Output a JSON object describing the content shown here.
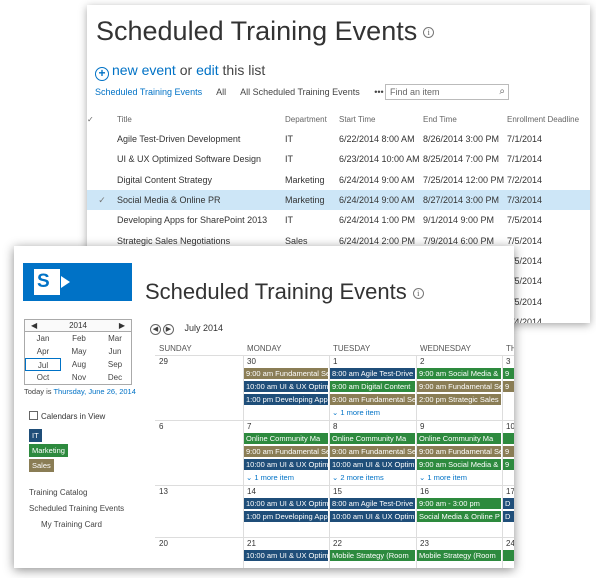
{
  "back": {
    "title": "Scheduled Training Events",
    "info_icon": "info-icon",
    "new_event": "new event",
    "or_text": "or",
    "edit": "edit",
    "this_list": "this list",
    "views": [
      "Scheduled Training Events",
      "All",
      "All Scheduled Training Events",
      "•••"
    ],
    "search_placeholder": "Find an item",
    "columns": [
      "Title",
      "Department",
      "Start Time",
      "End Time",
      "Enrollment Deadline"
    ],
    "rows": [
      {
        "title": "Agile Test-Driven Development",
        "dept": "IT",
        "start": "6/22/2014 8:00 AM",
        "end": "8/26/2014 3:00 PM",
        "deadline": "7/1/2014",
        "selected": false
      },
      {
        "title": "UI & UX Optimized Software Design",
        "dept": "IT",
        "start": "6/23/2014 10:00 AM",
        "end": "8/25/2014 7:00 PM",
        "deadline": "7/1/2014",
        "selected": false
      },
      {
        "title": "Digital Content Strategy",
        "dept": "Marketing",
        "start": "6/24/2014 9:00 AM",
        "end": "7/25/2014 12:00 PM",
        "deadline": "7/2/2014",
        "selected": false
      },
      {
        "title": "Social Media & Online PR",
        "dept": "Marketing",
        "start": "6/24/2014 9:00 AM",
        "end": "8/27/2014 3:00 PM",
        "deadline": "7/3/2014",
        "selected": true
      },
      {
        "title": "Developing Apps for SharePoint 2013",
        "dept": "IT",
        "start": "6/24/2014 1:00 PM",
        "end": "9/1/2014 9:00 PM",
        "deadline": "7/5/2014",
        "selected": false
      },
      {
        "title": "Strategic Sales Negotiations",
        "dept": "Sales",
        "start": "6/24/2014 2:00 PM",
        "end": "7/9/2014 6:00 PM",
        "deadline": "7/5/2014",
        "selected": false
      }
    ],
    "extra_deadlines": [
      "7/5/2014",
      "7/5/2014",
      "7/5/2014",
      "7/4/2014"
    ]
  },
  "front": {
    "title": "Scheduled Training Events",
    "logo_letter": "S",
    "mini_cal": {
      "year": "2014",
      "months": [
        "Jan",
        "Feb",
        "Mar",
        "Apr",
        "May",
        "Jun",
        "Jul",
        "Aug",
        "Sep",
        "Oct",
        "Nov",
        "Dec"
      ],
      "current": "Jul",
      "today_label": "Today is",
      "today_date": "Thursday, June 26, 2014"
    },
    "calendars_label": "Calendars in View",
    "calendars": [
      {
        "name": "IT",
        "color": "#1f4e79"
      },
      {
        "name": "Marketing",
        "color": "#2d8a3e"
      },
      {
        "name": "Sales",
        "color": "#8a7d55"
      }
    ],
    "nav_links": [
      "Training Catalog",
      "Scheduled Training Events",
      "My Training Card"
    ],
    "month_label": "July 2014",
    "day_headers": [
      "SUNDAY",
      "MONDAY",
      "TUESDAY",
      "WEDNESDAY",
      "TH"
    ],
    "weeks": [
      {
        "days": [
          "29",
          "30",
          "1",
          "2",
          "3"
        ],
        "events": [
          {
            "col": 1,
            "row": 0,
            "text": "9:00 am Fundamental Se",
            "color": "olive"
          },
          {
            "col": 1,
            "row": 1,
            "text": "10:00 am UI & UX Optim",
            "color": "navy"
          },
          {
            "col": 1,
            "row": 2,
            "text": "1:00 pm Developing App",
            "color": "navy"
          },
          {
            "col": 2,
            "row": 0,
            "text": "8:00 am Agile Test-Drive",
            "color": "navy"
          },
          {
            "col": 2,
            "row": 1,
            "text": "9:00 am Digital Content",
            "color": "green"
          },
          {
            "col": 2,
            "row": 2,
            "text": "9:00 am Fundamental Se",
            "color": "olive"
          },
          {
            "col": 3,
            "row": 0,
            "text": "9:00 am Social Media &",
            "color": "green"
          },
          {
            "col": 3,
            "row": 1,
            "text": "9:00 am Fundamental Se",
            "color": "olive"
          },
          {
            "col": 3,
            "row": 2,
            "text": "2:00 pm Strategic Sales N",
            "color": "olive"
          },
          {
            "col": 4,
            "row": 0,
            "text": "9",
            "color": "green"
          },
          {
            "col": 4,
            "row": 1,
            "text": "9",
            "color": "olive"
          }
        ],
        "more": [
          {
            "col": 2,
            "text": "1 more item"
          }
        ]
      },
      {
        "days": [
          "6",
          "7",
          "8",
          "9",
          "10"
        ],
        "events": [
          {
            "col": 1,
            "row": 0,
            "text": "Online Community Ma",
            "color": "green"
          },
          {
            "col": 1,
            "row": 1,
            "text": "9:00 am Fundamental Se",
            "color": "olive"
          },
          {
            "col": 1,
            "row": 2,
            "text": "10:00 am UI & UX Optim",
            "color": "navy"
          },
          {
            "col": 2,
            "row": 0,
            "text": "Online Community Ma",
            "color": "green"
          },
          {
            "col": 2,
            "row": 1,
            "text": "9:00 am Fundamental Se",
            "color": "olive"
          },
          {
            "col": 2,
            "row": 2,
            "text": "10:00 am UI & UX Optim",
            "color": "navy"
          },
          {
            "col": 3,
            "row": 0,
            "text": "Online Community Ma",
            "color": "green"
          },
          {
            "col": 3,
            "row": 1,
            "text": "9:00 am Fundamental Se",
            "color": "olive"
          },
          {
            "col": 3,
            "row": 2,
            "text": "9:00 am Social Media &",
            "color": "green"
          },
          {
            "col": 4,
            "row": 0,
            "text": "",
            "color": "green"
          },
          {
            "col": 4,
            "row": 1,
            "text": "9",
            "color": "olive"
          },
          {
            "col": 4,
            "row": 2,
            "text": "9",
            "color": "green"
          }
        ],
        "more": [
          {
            "col": 1,
            "text": "1 more item"
          },
          {
            "col": 2,
            "text": "2 more items"
          },
          {
            "col": 3,
            "text": "1 more item"
          }
        ]
      },
      {
        "days": [
          "13",
          "14",
          "15",
          "16",
          "17"
        ],
        "events": [
          {
            "col": 1,
            "row": 0,
            "text": "10:00 am UI & UX Optim",
            "color": "navy"
          },
          {
            "col": 1,
            "row": 1,
            "text": "1:00 pm Developing App",
            "color": "navy"
          },
          {
            "col": 2,
            "row": 0,
            "text": "8:00 am Agile Test-Drive",
            "color": "navy"
          },
          {
            "col": 2,
            "row": 1,
            "text": "10:00 am UI & UX Optim",
            "color": "navy"
          },
          {
            "col": 3,
            "row": 0,
            "text": "9:00 am - 3:00 pm",
            "color": "green"
          },
          {
            "col": 3,
            "row": 1,
            "text": "Social Media & Online P",
            "color": "green"
          },
          {
            "col": 4,
            "row": 0,
            "text": "D",
            "color": "navy"
          },
          {
            "col": 4,
            "row": 1,
            "text": "D",
            "color": "navy"
          }
        ],
        "more": []
      },
      {
        "days": [
          "20",
          "21",
          "22",
          "23",
          "24"
        ],
        "events": [
          {
            "col": 1,
            "row": 0,
            "text": "10:00 am UI & UX Optim",
            "color": "navy"
          },
          {
            "col": 2,
            "row": 0,
            "text": "Mobile Strategy (Room",
            "color": "green"
          },
          {
            "col": 3,
            "row": 0,
            "text": "Mobile Strategy (Room",
            "color": "green"
          },
          {
            "col": 4,
            "row": 0,
            "text": "",
            "color": "green"
          }
        ],
        "more": []
      }
    ]
  }
}
